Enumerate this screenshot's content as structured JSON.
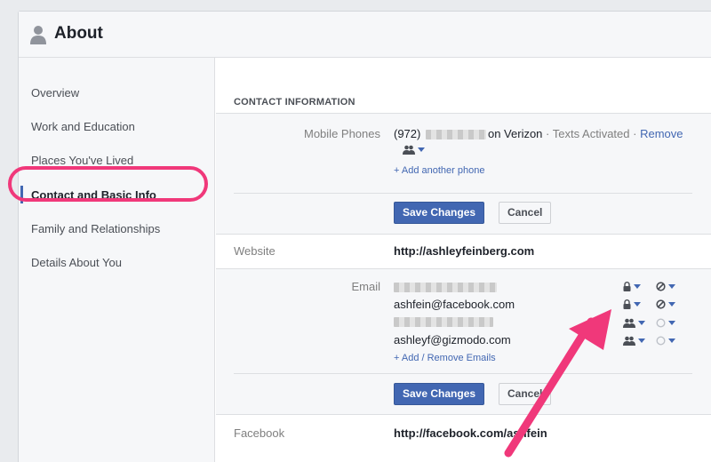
{
  "header": {
    "title": "About",
    "icon": "person-icon"
  },
  "sidebar": {
    "items": [
      {
        "label": "Overview",
        "active": false
      },
      {
        "label": "Work and Education",
        "active": false
      },
      {
        "label": "Places You've Lived",
        "active": false
      },
      {
        "label": "Contact and Basic Info",
        "active": true
      },
      {
        "label": "Family and Relationships",
        "active": false
      },
      {
        "label": "Details About You",
        "active": false
      }
    ]
  },
  "contact": {
    "section_title": "CONTACT INFORMATION",
    "phones": {
      "label": "Mobile Phones",
      "number_prefix": "(972)",
      "carrier": "on Verizon",
      "separator": "·",
      "status": "Texts Activated",
      "remove": "Remove",
      "add_link": "+ Add another phone"
    },
    "save_label": "Save Changes",
    "cancel_label": "Cancel",
    "website": {
      "label": "Website",
      "value": "http://ashleyfeinberg.com"
    },
    "email": {
      "label": "Email",
      "entries": [
        {
          "value": "",
          "blurred": true,
          "audience": "lock-icon",
          "visibility": "blocked-icon"
        },
        {
          "value": "ashfein@facebook.com",
          "blurred": false,
          "audience": "lock-icon",
          "visibility": "blocked-icon"
        },
        {
          "value": "",
          "blurred": true,
          "audience": "friends-icon",
          "visibility": "empty-circle-icon"
        },
        {
          "value": "ashleyf@gizmodo.com",
          "blurred": false,
          "audience": "friends-icon",
          "visibility": "empty-circle-icon"
        }
      ],
      "add_link": "+ Add / Remove Emails"
    },
    "facebook": {
      "label": "Facebook",
      "value": "http://facebook.com/ashfein"
    }
  },
  "colors": {
    "accent": "#4267b2",
    "highlight": "#f0387a",
    "annotation_arrow": "#f0387a"
  }
}
